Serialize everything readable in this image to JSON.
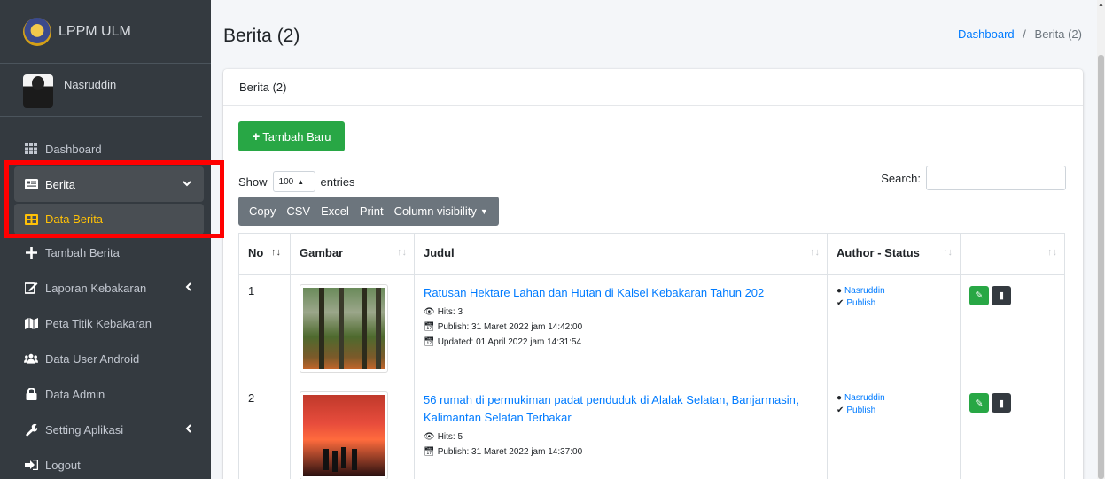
{
  "sidebar": {
    "brand": "LPPM ULM",
    "user": "Nasruddin",
    "items": [
      {
        "label": "Dashboard",
        "icon": "grid-icon"
      },
      {
        "label": "Berita",
        "icon": "newspaper-icon"
      },
      {
        "label": "Data Berita",
        "icon": "table-icon"
      },
      {
        "label": "Tambah Berita",
        "icon": "plus-icon"
      },
      {
        "label": "Laporan Kebakaran",
        "icon": "edit-icon"
      },
      {
        "label": "Peta Titik Kebakaran",
        "icon": "map-icon"
      },
      {
        "label": "Data User Android",
        "icon": "users-icon"
      },
      {
        "label": "Data Admin",
        "icon": "user-lock-icon"
      },
      {
        "label": "Setting Aplikasi",
        "icon": "wrench-icon"
      },
      {
        "label": "Logout",
        "icon": "logout-icon"
      }
    ]
  },
  "header": {
    "title": "Berita (2)",
    "breadcrumb": [
      "Dashboard",
      "Berita (2)"
    ]
  },
  "card": {
    "title": "Berita (2)",
    "add_button": "Tambah Baru",
    "show_label": "Show",
    "entries_value": "100",
    "entries_label": "entries",
    "search_label": "Search:",
    "export_buttons": [
      "Copy",
      "CSV",
      "Excel",
      "Print",
      "Column visibility"
    ]
  },
  "table": {
    "columns": [
      "No",
      "Gambar",
      "Judul",
      "Author - Status",
      ""
    ],
    "rows": [
      {
        "no": "1",
        "title": "Ratusan Hektare Lahan dan Hutan di Kalsel Kebakaran Tahun 202",
        "hits": "Hits: 3",
        "publish": "Publish: 31 Maret 2022 jam 14:42:00",
        "updated": "Updated: 01 April 2022 jam 14:31:54",
        "author": "Nasruddin",
        "status": "Publish"
      },
      {
        "no": "2",
        "title": "56 rumah di permukiman padat penduduk di Alalak Selatan, Banjarmasin, Kalimantan Selatan Terbakar",
        "hits": "Hits: 5",
        "publish": "Publish: 31 Maret 2022 jam 14:37:00",
        "updated": "",
        "author": "Nasruddin",
        "status": "Publish"
      }
    ]
  },
  "colors": {
    "sidebar_bg": "#343a40",
    "active": "#ffc107",
    "success": "#28a745",
    "link": "#007bff",
    "highlight": "#ff0000"
  }
}
